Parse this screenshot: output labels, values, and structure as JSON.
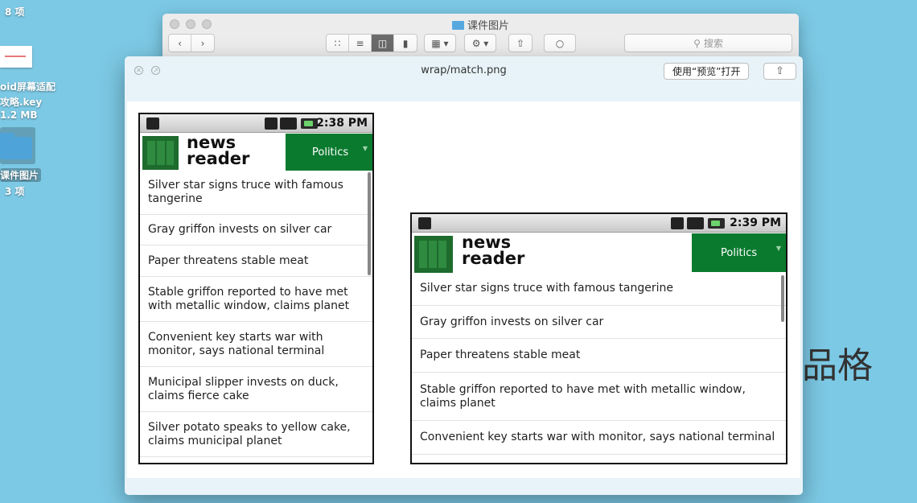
{
  "desktop": {
    "item1": {
      "size": "8 项"
    },
    "item2": {
      "name_line1": "oid屏幕适配",
      "name_line2": "攻略.key",
      "size": "1.2 MB"
    },
    "item3": {
      "name": "课件图片",
      "size": "3 项"
    }
  },
  "finder": {
    "title": "课件图片",
    "search_placeholder": "搜索",
    "icons": [
      "back-icon",
      "forward-icon",
      "icon-view-icon",
      "list-view-icon",
      "column-view-icon",
      "coverflow-view-icon",
      "arrange-icon",
      "gear-icon",
      "share-icon",
      "tag-icon",
      "search-icon"
    ]
  },
  "quicklook": {
    "title": "wrap/match.png",
    "open_button": "使用“预览”打开"
  },
  "phone_left": {
    "time": "2:38 PM",
    "brand_line1": "news",
    "brand_line2": "reader",
    "category": "Politics",
    "items": [
      "Silver star signs truce with famous tangerine",
      "Gray griffon invests on silver car",
      "Paper threatens stable meat",
      "Stable griffon reported to have met with metallic window, claims planet",
      "Convenient key starts war with monitor, says national terminal",
      "Municipal slipper invests on duck, claims fierce cake",
      "Silver potato speaks to yellow cake, claims municipal planet"
    ]
  },
  "phone_right": {
    "time": "2:39 PM",
    "brand_line1": "news",
    "brand_line2": "reader",
    "category": "Politics",
    "items": [
      "Silver star signs truce with famous tangerine",
      "Gray griffon invests on silver car",
      "Paper threatens stable meat",
      "Stable griffon reported to have met with metallic window, claims planet",
      "Convenient key starts war with monitor, says national terminal"
    ]
  },
  "background_text": "品格",
  "colors": {
    "desktop": "#7cc9e5",
    "android_green": "#0a7a2e",
    "logo_green": "#1e6b2e"
  }
}
